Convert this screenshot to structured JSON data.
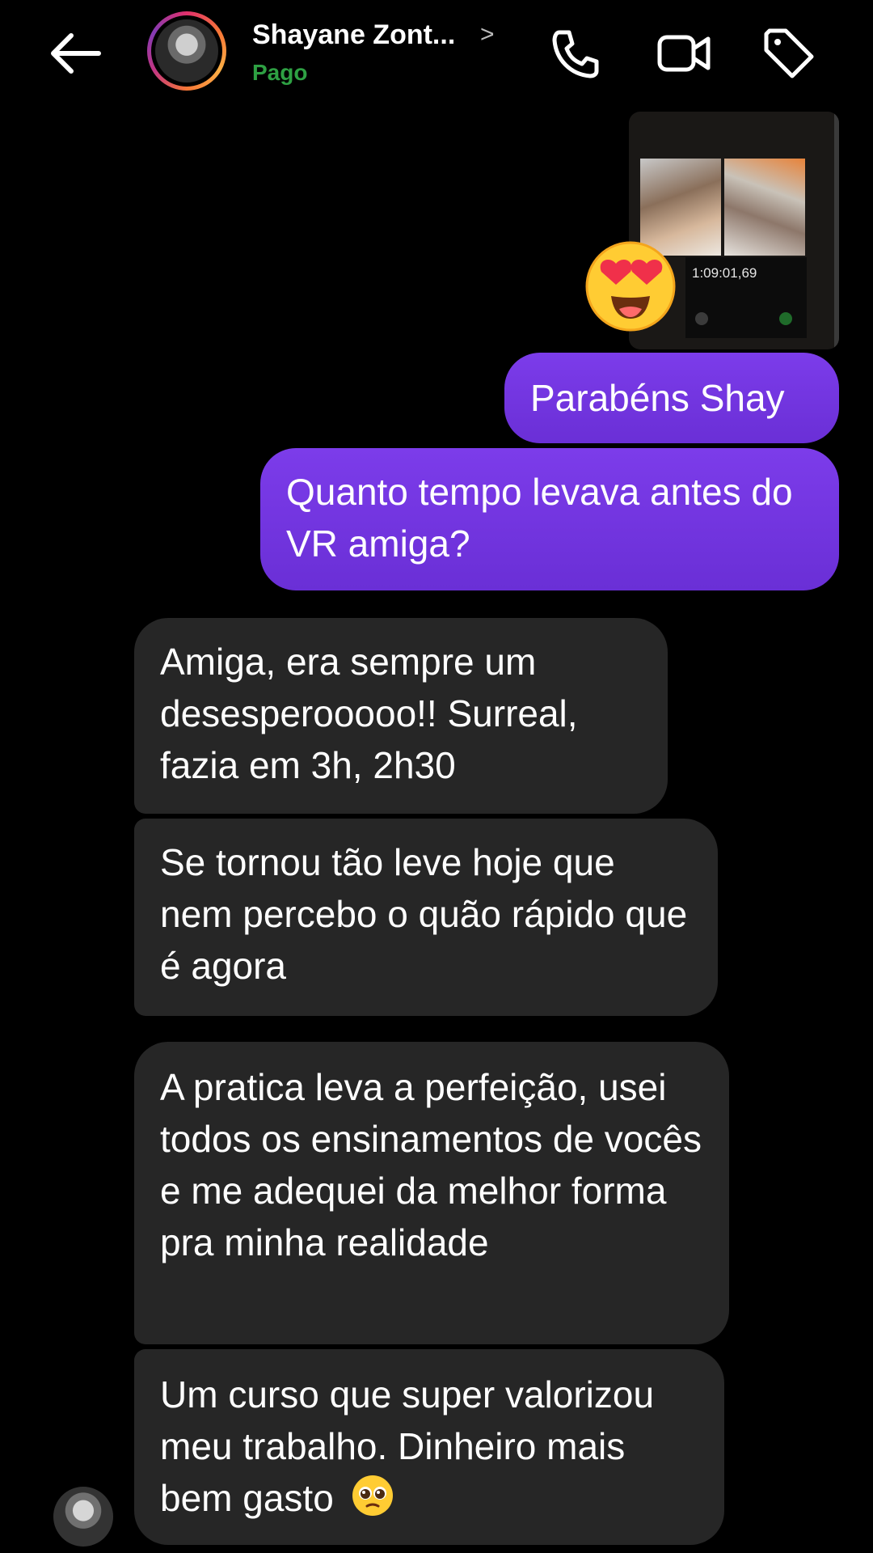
{
  "header": {
    "contact_name": "Shayane Zont...",
    "status": "Pago",
    "chevron": ">"
  },
  "media": {
    "timer_text": "1:09:01,69",
    "reaction_icon": "heart-eyes-emoji"
  },
  "messages": [
    {
      "side": "sent",
      "text": "Parabéns Shay"
    },
    {
      "side": "sent",
      "text": "Quanto tempo levava antes do VR amiga?"
    },
    {
      "side": "received",
      "text": "Amiga, era sempre um desesperooooo!! Surreal, fazia em 3h, 2h30"
    },
    {
      "side": "received",
      "text": "Se tornou tão leve hoje que nem percebo o quão rápido que é agora"
    },
    {
      "side": "received",
      "text": "A pratica leva a perfeição, usei todos os ensinamentos de vocês e me adequei da melhor forma pra minha realidade"
    },
    {
      "side": "received",
      "text": "Um curso que super valorizou meu trabalho. Dinheiro mais bem gasto"
    }
  ],
  "colors": {
    "sent_bubble": "#7c3cea",
    "received_bubble": "#262626",
    "status_green": "#2ea043"
  }
}
